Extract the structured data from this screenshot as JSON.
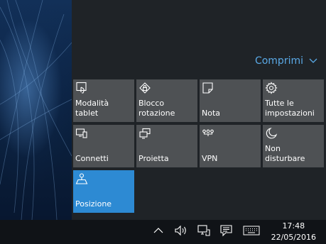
{
  "action_center": {
    "collapse_label": "Comprimi",
    "collapse_icon": "chevron-down-icon",
    "accent_color": "#2d8ad3",
    "tiles": [
      {
        "label": "Modalità\ntablet",
        "icon": "tablet-mode-icon",
        "active": false
      },
      {
        "label": "Blocco\nrotazione",
        "icon": "rotation-lock-icon",
        "active": false
      },
      {
        "label": "Nota",
        "icon": "note-icon",
        "active": false
      },
      {
        "label": "Tutte le\nimpostazioni",
        "icon": "gear-icon",
        "active": false
      },
      {
        "label": "Connetti",
        "icon": "connect-icon",
        "active": false
      },
      {
        "label": "Proietta",
        "icon": "project-icon",
        "active": false
      },
      {
        "label": "VPN",
        "icon": "vpn-icon",
        "active": false
      },
      {
        "label": "Non disturbare",
        "icon": "moon-icon",
        "active": false
      },
      {
        "label": "Posizione",
        "icon": "location-icon",
        "active": true
      }
    ]
  },
  "taskbar": {
    "tray_icons": [
      "chevron-up-icon",
      "volume-icon",
      "network-icon",
      "action-center-icon",
      "keyboard-icon"
    ],
    "time": "17:48",
    "date": "22/05/2016"
  }
}
